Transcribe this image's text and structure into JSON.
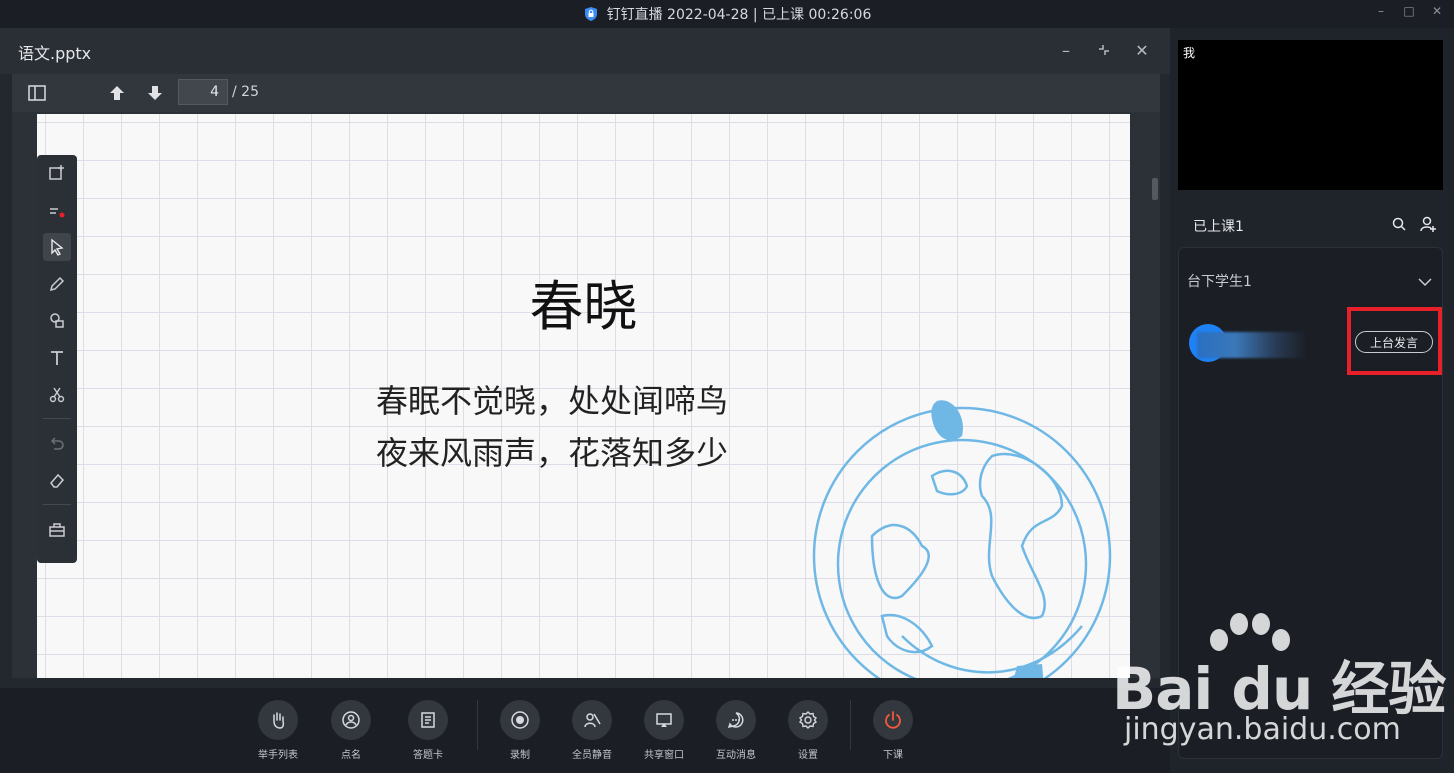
{
  "window": {
    "title": "钉钉直播 2022-04-28 | 已上课 00:26:06"
  },
  "document": {
    "title": "语文.pptx",
    "current_page": "4",
    "total_pages": "/ 25"
  },
  "slide": {
    "title": "春晓",
    "lines": [
      "春眠不觉晓，处处闻啼鸟",
      "夜来风雨声，花落知多少"
    ]
  },
  "toolbar_bottom": {
    "buttons": [
      {
        "label": "举手列表",
        "icon": "raise-hand-icon"
      },
      {
        "label": "点名",
        "icon": "roll-call-icon"
      },
      {
        "label": "答题卡",
        "icon": "answer-card-icon"
      },
      {
        "label": "录制",
        "icon": "record-icon"
      },
      {
        "label": "全员静音",
        "icon": "mute-all-icon"
      },
      {
        "label": "共享窗口",
        "icon": "share-window-icon"
      },
      {
        "label": "互动消息",
        "icon": "message-icon"
      },
      {
        "label": "设置",
        "icon": "settings-icon"
      },
      {
        "label": "下课",
        "icon": "power-icon"
      }
    ]
  },
  "right_panel": {
    "video_label": "我",
    "class_title": "已上课1",
    "group_label": "台下学生1",
    "stage_button": "上台发言"
  },
  "watermark": {
    "brand": "Bai du 经验",
    "url": "jingyan.baidu.com"
  },
  "colors": {
    "accent": "#1e82f5",
    "end_class": "#f05a3c",
    "highlight": "#e8202a"
  }
}
